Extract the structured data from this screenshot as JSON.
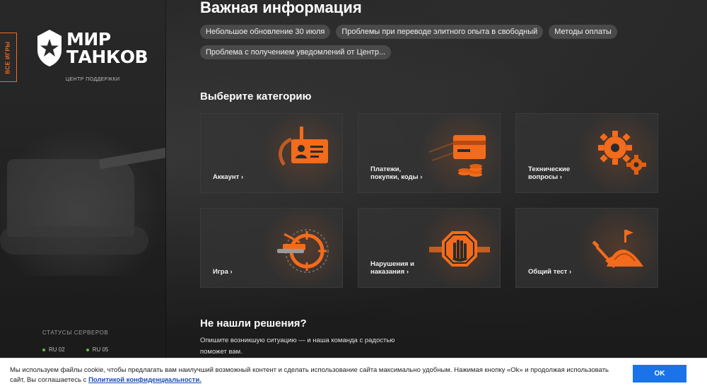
{
  "sidebar": {
    "games_tab": "ВСЕ ИГРЫ",
    "logo_line1": "МИР",
    "logo_line2": "ТАНКОВ",
    "support_caption": "ЦЕНТР ПОДДЕРЖКИ",
    "servers_title": "СТАТУСЫ СЕРВЕРОВ",
    "servers": [
      {
        "name": "RU 02",
        "status_color": "#5ec04a"
      },
      {
        "name": "RU 05",
        "status_color": "#5ec04a"
      }
    ]
  },
  "main": {
    "title": "Важная информация",
    "chips": [
      "Небольшое обновление 30 июля",
      "Проблемы при переводе элитного опыта в свободный",
      "Методы оплаты",
      "Проблема с получением уведомлений от Центр..."
    ],
    "categories_title": "Выберите категорию",
    "categories": [
      {
        "label": "Аккаунт",
        "icon": "id-card-icon"
      },
      {
        "label": "Платежи,\nпокупки, коды",
        "icon": "payment-card-icon"
      },
      {
        "label": "Технические\nвопросы",
        "icon": "gears-icon"
      },
      {
        "label": "Игра",
        "icon": "crosshair-icon"
      },
      {
        "label": "Нарушения и\nнаказания",
        "icon": "stop-hand-icon"
      },
      {
        "label": "Общий тест",
        "icon": "sand-shovel-icon"
      }
    ],
    "not_found_title": "Не нашли решения?",
    "not_found_text": "Опишите возникшую ситуацию — и наша команда с радостью поможет вам."
  },
  "cookie": {
    "text": "Мы используем файлы cookie, чтобы предлагать вам наилучший возможный контент и сделать использование сайта максимально удобным. Нажимая кнопку «Ok» и продолжая использовать сайт, Вы соглашаетесь с ",
    "link": "Политикой конфиденциальности.",
    "ok": "OK"
  },
  "colors": {
    "accent": "#f36b1c",
    "button": "#1a73e8"
  }
}
